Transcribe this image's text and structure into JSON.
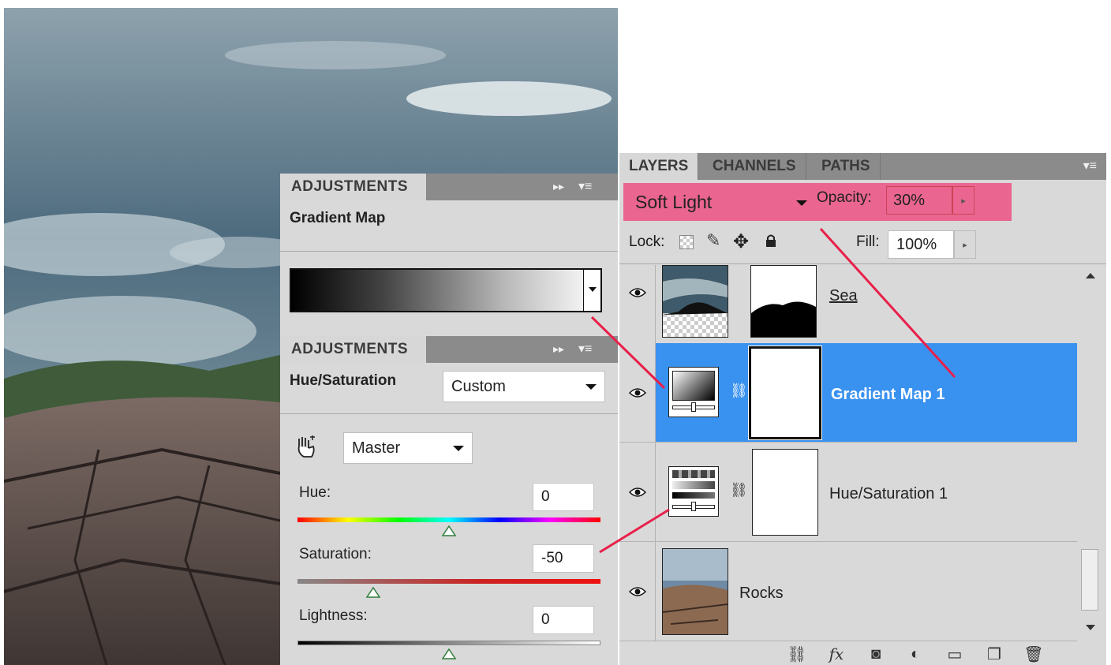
{
  "adjustments_top": {
    "tab_label": "ADJUSTMENTS",
    "title": "Gradient Map"
  },
  "adjustments_bottom": {
    "tab_label": "ADJUSTMENTS",
    "title": "Hue/Saturation",
    "preset_value": "Custom",
    "channel_value": "Master",
    "hue_label": "Hue:",
    "hue_value": "0",
    "saturation_label": "Saturation:",
    "saturation_value": "-50",
    "lightness_label": "Lightness:",
    "lightness_value": "0",
    "hue_level": 0.5,
    "saturation_level": 0.25,
    "lightness_level": 0.5
  },
  "layers_panel": {
    "tabs": [
      "LAYERS",
      "CHANNELS",
      "PATHS"
    ],
    "blend_mode": "Soft Light",
    "opacity_label": "Opacity:",
    "opacity_value": "30%",
    "lock_label": "Lock:",
    "fill_label": "Fill:",
    "fill_value": "100%",
    "layers": [
      {
        "name": "Sea",
        "selected": false
      },
      {
        "name": "Gradient Map 1",
        "selected": true
      },
      {
        "name": "Hue/Saturation 1",
        "selected": false
      },
      {
        "name": "Rocks",
        "selected": false
      }
    ]
  },
  "colors": {
    "highlight": "#ea6590",
    "selection": "#3a92f0",
    "annotation_line": "#e8204a"
  },
  "icons": [
    "eye-icon",
    "chain-link-icon",
    "fx-icon",
    "mask-icon",
    "adjustment-icon",
    "folder-icon",
    "new-layer-icon",
    "trash-icon",
    "panel-menu-icon",
    "collapse-icon",
    "hand-target-icon"
  ]
}
